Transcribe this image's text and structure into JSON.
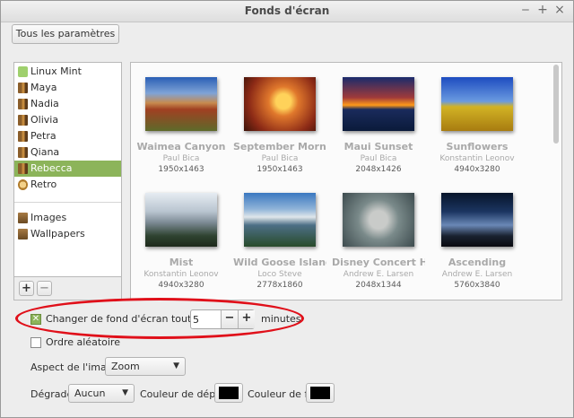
{
  "window": {
    "title": "Fonds d'écran",
    "controls": [
      "‒",
      "+",
      "×"
    ]
  },
  "toolbar": {
    "all_settings": "Tous les paramètres"
  },
  "sidebar": {
    "items": [
      {
        "label": "Linux Mint",
        "icon": "linux-mint-icon"
      },
      {
        "label": "Maya",
        "icon": "folder-icon"
      },
      {
        "label": "Nadia",
        "icon": "folder-icon"
      },
      {
        "label": "Olivia",
        "icon": "folder-icon"
      },
      {
        "label": "Petra",
        "icon": "folder-icon"
      },
      {
        "label": "Qiana",
        "icon": "folder-icon"
      },
      {
        "label": "Rebecca",
        "icon": "folder-icon",
        "selected": true
      },
      {
        "label": "Retro",
        "icon": "retro-icon"
      }
    ],
    "folders": [
      {
        "label": "Images",
        "icon": "images-folder-icon"
      },
      {
        "label": "Wallpapers",
        "icon": "wallpapers-folder-icon"
      }
    ],
    "add_label": "+",
    "remove_label": "−"
  },
  "gallery": {
    "items": [
      {
        "name": "Waimea Canyon",
        "author": "Paul Bica",
        "resolution": "1950x1463"
      },
      {
        "name": "September Morni...",
        "author": "Paul Bica",
        "resolution": "1950x1463"
      },
      {
        "name": "Maui Sunset",
        "author": "Paul Bica",
        "resolution": "2048x1426"
      },
      {
        "name": "Sunflowers",
        "author": "Konstantin Leonov",
        "resolution": "4940x3280"
      },
      {
        "name": "Mist",
        "author": "Konstantin Leonov",
        "resolution": "4940x3280"
      },
      {
        "name": "Wild Goose Island",
        "author": "Loco Steve",
        "resolution": "2778x1860"
      },
      {
        "name": "Disney Concert H...",
        "author": "Andrew E. Larsen",
        "resolution": "2048x1344"
      },
      {
        "name": "Ascending",
        "author": "Andrew E. Larsen",
        "resolution": "5760x3840"
      }
    ]
  },
  "options": {
    "change_label": "Changer de fond d'écran toutes les",
    "change_checked": true,
    "interval_value": "5",
    "minus_label": "−",
    "plus_label": "+",
    "minutes_label": "minutes",
    "random_label": "Ordre aléatoire",
    "random_checked": false,
    "aspect_label": "Aspect de l'image",
    "aspect_value": "Zoom",
    "gradient_label": "Dégradé",
    "gradient_value": "Aucun",
    "start_color_label": "Couleur de départ",
    "start_color": "#000000",
    "end_color_label": "Couleur de fin",
    "end_color": "#000000"
  },
  "accent_color": "#8cb45a",
  "highlight_color": "#e0101a"
}
